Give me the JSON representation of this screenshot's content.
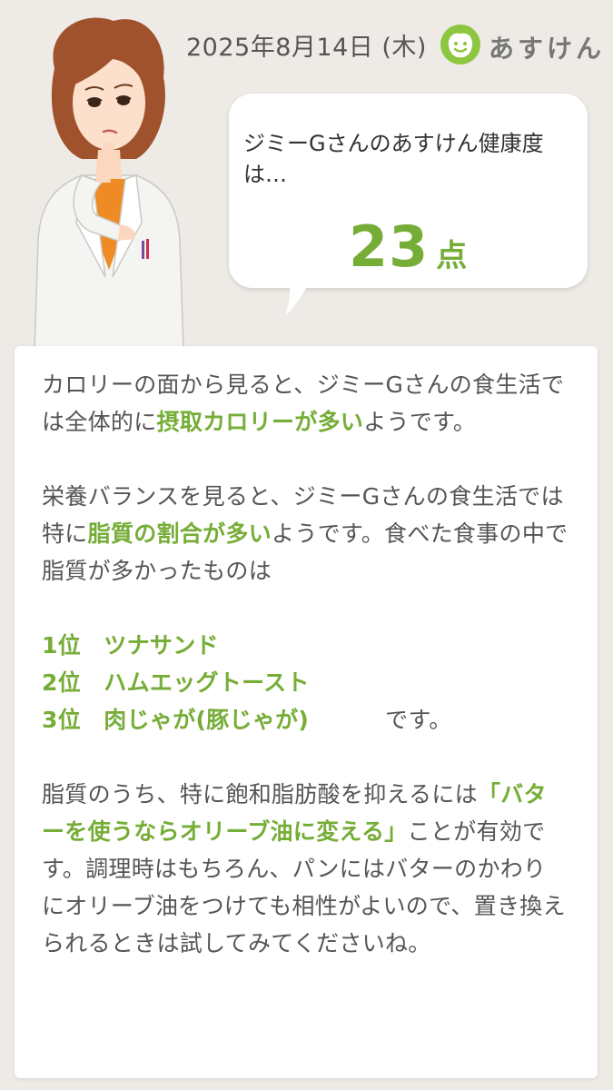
{
  "header": {
    "date": "2025年8月14日 (木)",
    "brand_name": "あすけん",
    "brand_logo_icon": "apple-face-icon",
    "brand_color": "#8dc63f"
  },
  "bubble": {
    "question": "ジミーGさんのあすけん健康度は…",
    "score_value": "23",
    "score_unit": "点"
  },
  "card": {
    "p1_before": "カロリーの面から見ると、ジミーGさんの食生活では全体的に",
    "p1_highlight": "摂取カロリーが多い",
    "p1_after": "ようです。",
    "p2_before": "栄養バランスを見ると、ジミーGさんの食生活では特に",
    "p2_highlight": "脂質の割合が多い",
    "p2_after": "ようです。食べた食事の中で脂質が多かったものは",
    "rank1": "1位　ツナサンド",
    "rank2": "2位　ハムエッグトースト",
    "rank3": "3位　肉じゃが(豚じゃが)",
    "p3_after": "です。",
    "p4_before": "脂質のうち、特に飽和脂肪酸を抑えるには",
    "p4_highlight": "「バターを使うならオリーブ油に変える」",
    "p4_after": "ことが有効です。調理時はもちろん、パンにはバターのかわりにオリーブ油をつけても相性がよいので、置き換えられるときは試してみてくださいね。"
  },
  "colors": {
    "accent_green": "#76ad37",
    "background": "#eeebe6"
  }
}
